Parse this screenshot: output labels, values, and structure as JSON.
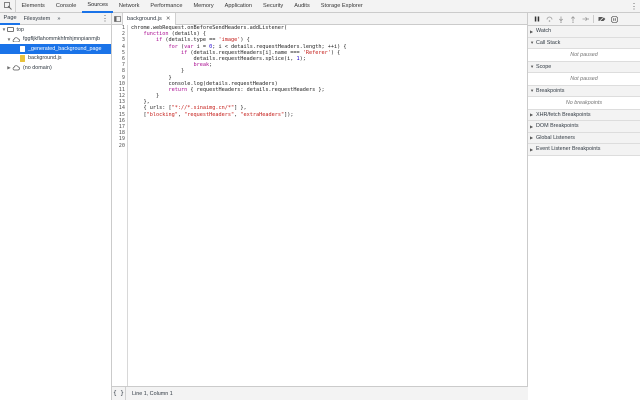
{
  "devtools_tabs": [
    "Elements",
    "Console",
    "Sources",
    "Network",
    "Performance",
    "Memory",
    "Application",
    "Security",
    "Audits",
    "Storage Explorer"
  ],
  "active_tab": "Sources",
  "navigator": {
    "tabs": [
      "Page",
      "Filesystem"
    ],
    "more": "»",
    "tree": {
      "top": "top",
      "extension": "fggfljkflahommkhfmhjmnpianmjb",
      "generated_file": "_generated_background_page",
      "background_file": "background.js",
      "no_domain": "(no domain)"
    }
  },
  "editor": {
    "open_tab": "background.js",
    "line_numbers": [
      "1",
      "2",
      "3",
      "4",
      "5",
      "6",
      "7",
      "8",
      "9",
      "10",
      "11",
      "12",
      "13",
      "14",
      "15",
      "16",
      "17",
      "18",
      "19",
      "20"
    ],
    "code": [
      "chrome.webRequest.onBeforeSendHeaders.addListener(",
      "    function (details) {",
      "        if (details.type == 'image') {",
      "            for (var i = 0; i < details.requestHeaders.length; ++i) {",
      "                if (details.requestHeaders[i].name === 'Referer') {",
      "                    details.requestHeaders.splice(i, 1);",
      "                    break;",
      "                }",
      "            }",
      "            console.log(details.requestHeaders)",
      "            return { requestHeaders: details.requestHeaders };",
      "        }",
      "    },",
      "    { urls: [\"*://*.sinaimg.cn/*\"] },",
      "    [\"blocking\", \"requestHeaders\", \"extraHeaders\"]);",
      "",
      "",
      "",
      "",
      ""
    ],
    "status": {
      "pretty_print": "{ }",
      "cursor": "Line 1, Column 1"
    }
  },
  "debugger": {
    "sections": {
      "watch": "Watch",
      "call_stack": "Call Stack",
      "call_stack_msg": "Not paused",
      "scope": "Scope",
      "scope_msg": "Not paused",
      "breakpoints": "Breakpoints",
      "breakpoints_msg": "No breakpoints",
      "xhr": "XHR/fetch Breakpoints",
      "dom": "DOM Breakpoints",
      "global": "Global Listeners",
      "event": "Event Listener Breakpoints"
    }
  },
  "colors": {
    "accent": "#1a73e8",
    "keyword": "#aa0d91",
    "string": "#c41a16",
    "number": "#1c00cf",
    "toolbar": "#f3f3f3"
  },
  "icons": [
    "inspect-icon",
    "kebab-menu-icon",
    "cloud-icon",
    "file-icon",
    "pause-icon",
    "step-over-icon",
    "step-into-icon",
    "step-out-icon",
    "step-icon",
    "deactivate-breakpoints-icon",
    "pause-on-exceptions-icon"
  ]
}
